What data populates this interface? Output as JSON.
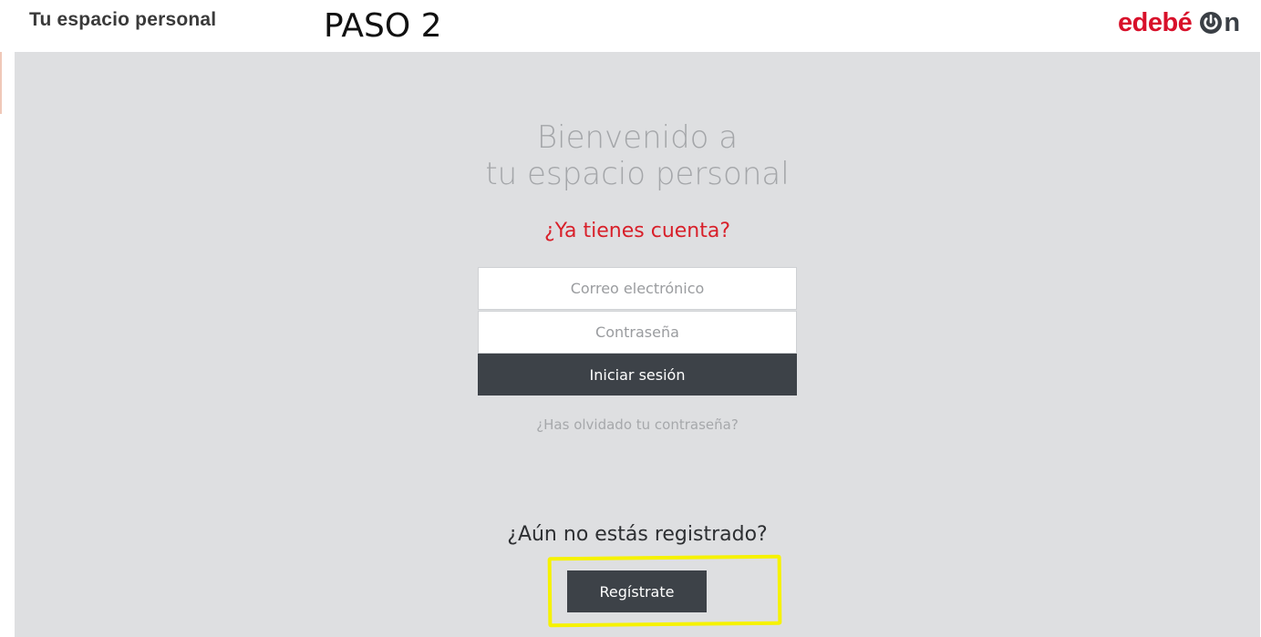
{
  "header": {
    "title": "Tu espacio personal",
    "step": "PASO 2",
    "logo": {
      "brand": "edebé",
      "suffix": "n",
      "icon": "power-icon",
      "brand_color": "#d8102a",
      "icon_color": "#3a3f45"
    }
  },
  "login": {
    "welcome_line1": "Bienvenido a",
    "welcome_line2": "tu espacio personal",
    "question": "¿Ya tienes cuenta?",
    "email_placeholder": "Correo electrónico",
    "password_placeholder": "Contraseña",
    "submit_label": "Iniciar sesión",
    "forgot_label": "¿Has olvidado tu contraseña?"
  },
  "register": {
    "question": "¿Aún no estás registrado?",
    "button_label": "Regístrate",
    "highlight_color": "#f6f200"
  },
  "colors": {
    "accent": "#d8202a",
    "button": "#3d4248",
    "background": "#dedfe1"
  }
}
